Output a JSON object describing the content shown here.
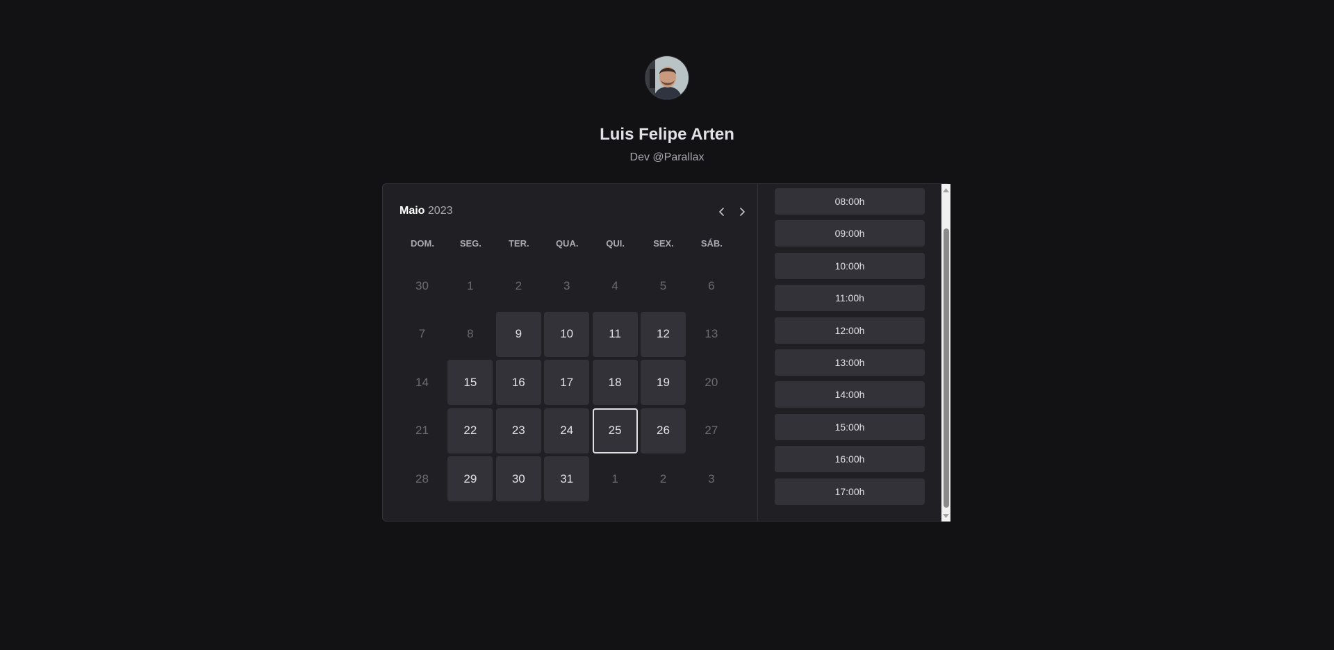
{
  "profile": {
    "name": "Luis Felipe Arten",
    "bio": "Dev @Parallax"
  },
  "calendar": {
    "month": "Maio",
    "year": "2023",
    "weekdays": [
      "DOM.",
      "SEG.",
      "TER.",
      "QUA.",
      "QUI.",
      "SEX.",
      "SÁB."
    ],
    "weeks": [
      [
        {
          "label": "30",
          "available": false
        },
        {
          "label": "1",
          "available": false
        },
        {
          "label": "2",
          "available": false
        },
        {
          "label": "3",
          "available": false
        },
        {
          "label": "4",
          "available": false
        },
        {
          "label": "5",
          "available": false
        },
        {
          "label": "6",
          "available": false
        }
      ],
      [
        {
          "label": "7",
          "available": false
        },
        {
          "label": "8",
          "available": false
        },
        {
          "label": "9",
          "available": true
        },
        {
          "label": "10",
          "available": true
        },
        {
          "label": "11",
          "available": true
        },
        {
          "label": "12",
          "available": true
        },
        {
          "label": "13",
          "available": false
        }
      ],
      [
        {
          "label": "14",
          "available": false
        },
        {
          "label": "15",
          "available": true
        },
        {
          "label": "16",
          "available": true
        },
        {
          "label": "17",
          "available": true
        },
        {
          "label": "18",
          "available": true
        },
        {
          "label": "19",
          "available": true
        },
        {
          "label": "20",
          "available": false
        }
      ],
      [
        {
          "label": "21",
          "available": false
        },
        {
          "label": "22",
          "available": true
        },
        {
          "label": "23",
          "available": true
        },
        {
          "label": "24",
          "available": true
        },
        {
          "label": "25",
          "available": true,
          "selected": true
        },
        {
          "label": "26",
          "available": true
        },
        {
          "label": "27",
          "available": false
        }
      ],
      [
        {
          "label": "28",
          "available": false
        },
        {
          "label": "29",
          "available": true
        },
        {
          "label": "30",
          "available": true
        },
        {
          "label": "31",
          "available": true
        },
        {
          "label": "1",
          "available": false
        },
        {
          "label": "2",
          "available": false
        },
        {
          "label": "3",
          "available": false
        }
      ]
    ]
  },
  "times": [
    "08:00h",
    "09:00h",
    "10:00h",
    "11:00h",
    "12:00h",
    "13:00h",
    "14:00h",
    "15:00h",
    "16:00h",
    "17:00h"
  ],
  "colors": {
    "background": "#121214",
    "panel": "#202024",
    "tile": "#323238",
    "text": "#e1e1e6",
    "muted": "#6b6b72"
  }
}
